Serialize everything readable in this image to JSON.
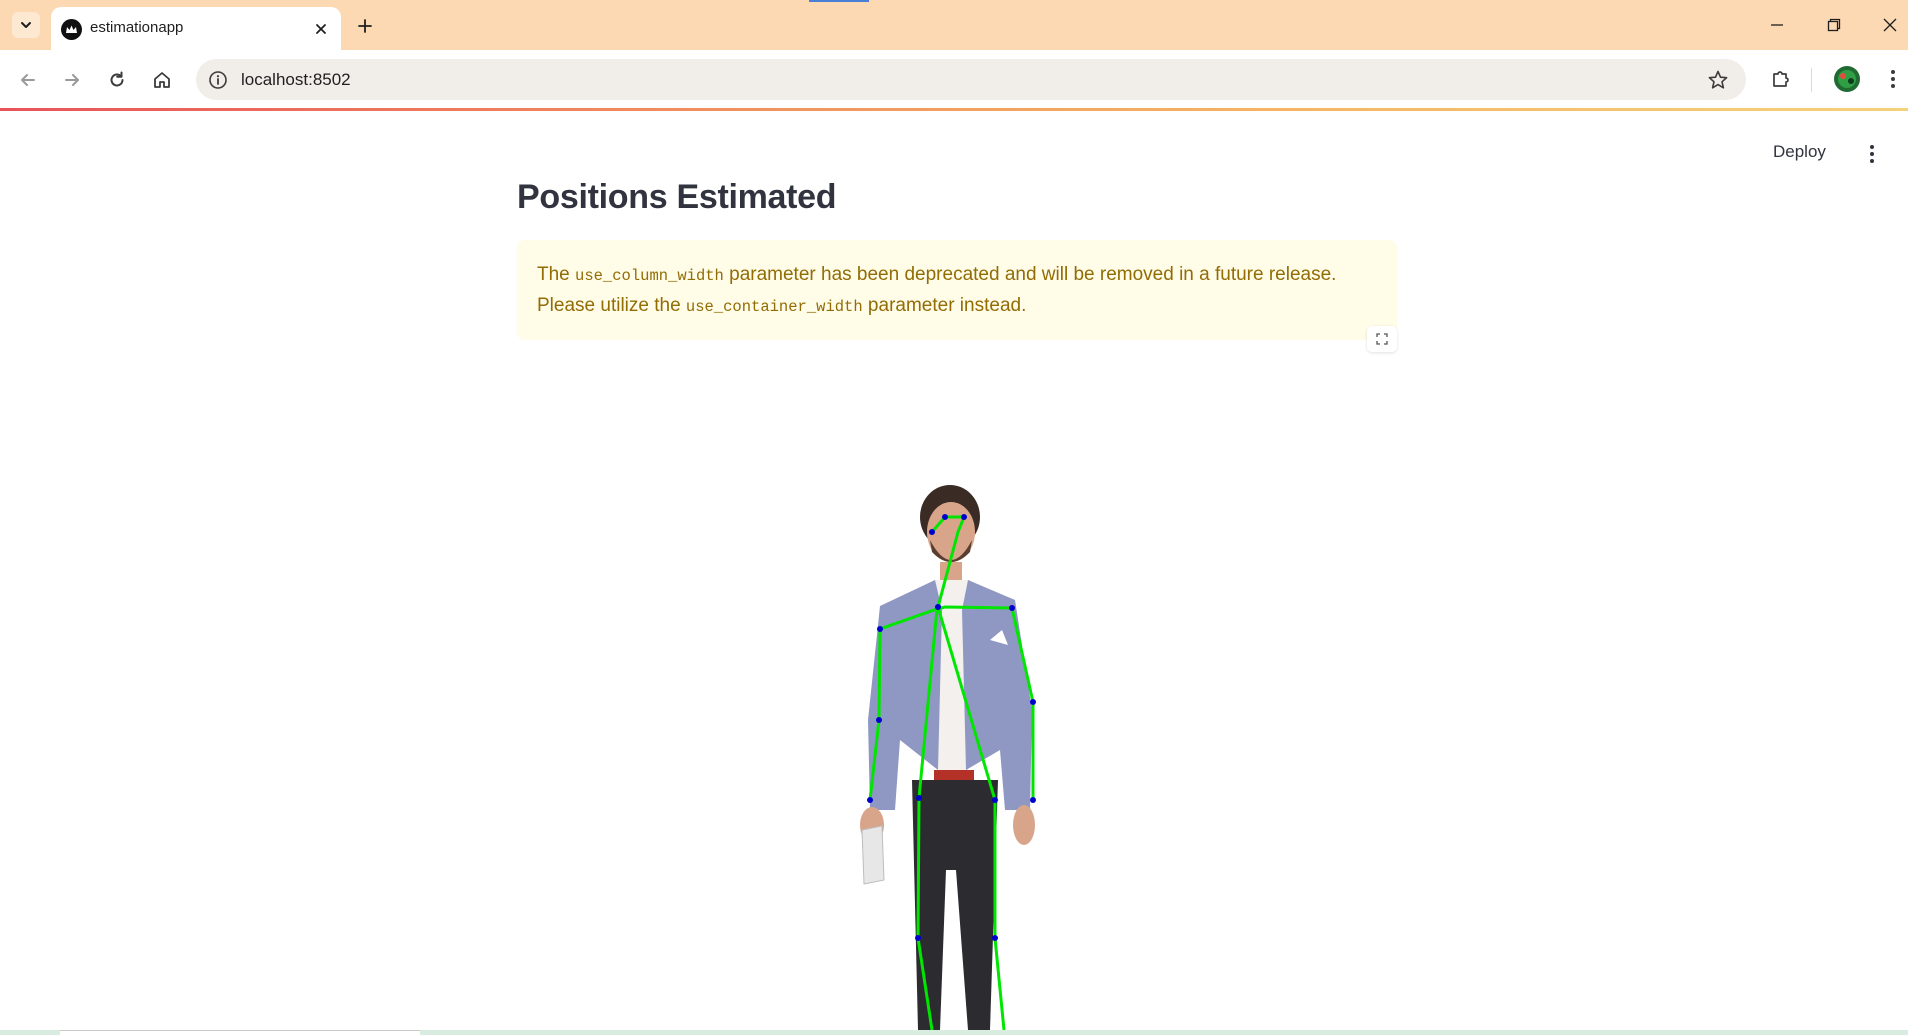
{
  "browser": {
    "tab_title": "estimationapp",
    "url": "localhost:8502"
  },
  "app": {
    "deploy_label": "Deploy",
    "title": "Positions Estimated",
    "warning": {
      "prefix": "The ",
      "code1": "use_column_width",
      "middle": " parameter has been deprecated and will be removed in a future release. Please utilize the ",
      "code2": "use_container_width",
      "suffix": " parameter instead."
    },
    "image": {
      "alt": "pose estimation of standing man",
      "skeleton_color": "#00e600",
      "keypoint_color": "#0000cc"
    }
  },
  "colors": {
    "tabbar_bg": "#fcd8b3",
    "warning_bg": "#fffce8",
    "warning_text": "#926c05",
    "title_text": "#31333f"
  },
  "icons": {
    "tab_dropdown": "chevron-down-icon",
    "tab_favicon": "streamlit-crown-icon",
    "tab_close": "close-icon",
    "new_tab": "plus-icon",
    "minimize": "minimize-icon",
    "restore": "restore-icon",
    "close_window": "close-icon",
    "back": "arrow-left-icon",
    "forward": "arrow-right-icon",
    "reload": "reload-icon",
    "home": "home-icon",
    "site_info": "info-icon",
    "bookmark": "star-icon",
    "extensions": "puzzle-icon",
    "profile": "avatar",
    "browser_menu": "kebab-menu-icon",
    "app_menu": "kebab-menu-icon",
    "fullscreen": "fullscreen-icon"
  }
}
